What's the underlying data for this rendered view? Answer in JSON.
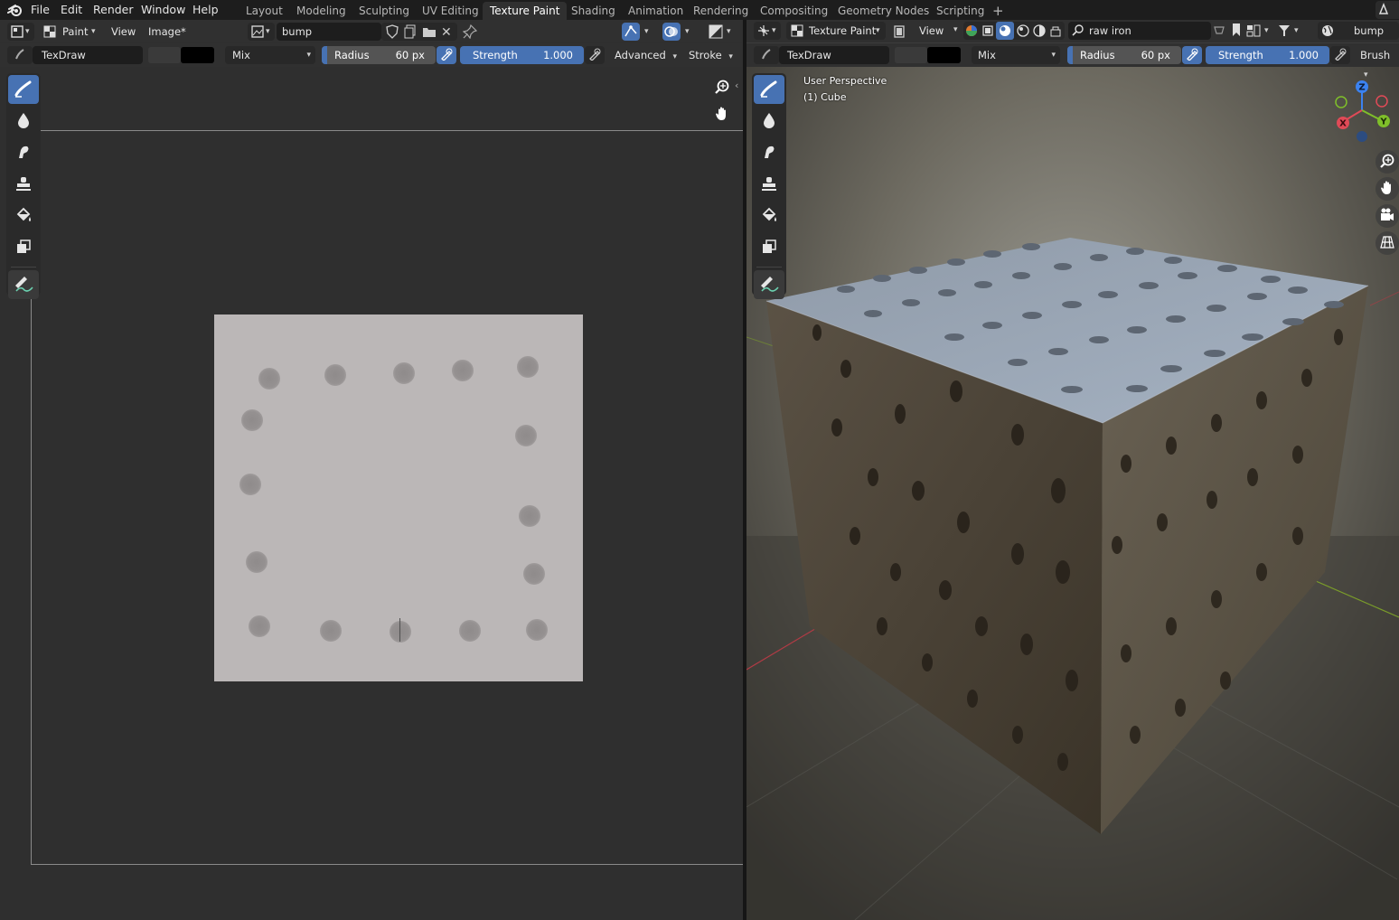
{
  "menu": {
    "items": [
      "File",
      "Edit",
      "Render",
      "Window",
      "Help"
    ]
  },
  "workspaces": {
    "tabs": [
      "Layout",
      "Modeling",
      "Sculpting",
      "UV Editing",
      "Texture Paint",
      "Shading",
      "Animation",
      "Rendering",
      "Compositing",
      "Geometry Nodes",
      "Scripting"
    ],
    "active": "Texture Paint",
    "add_label": "+"
  },
  "image_editor": {
    "header": {
      "mode": "Paint",
      "view": "View",
      "image_menu": "Image*",
      "image_name": "bump"
    },
    "tool_settings": {
      "brush": "TexDraw",
      "blend": "Mix",
      "radius_label": "Radius",
      "radius_value": "60 px",
      "strength_label": "Strength",
      "strength_value": "1.000",
      "advanced": "Advanced",
      "stroke": "Stroke"
    }
  },
  "viewport": {
    "header": {
      "mode": "Texture Paint",
      "view": "View",
      "material_search": "raw iron",
      "image_name": "bump"
    },
    "tool_settings": {
      "brush": "TexDraw",
      "blend": "Mix",
      "radius_label": "Radius",
      "radius_value": "60 px",
      "strength_label": "Strength",
      "strength_value": "1.000",
      "brush_panel": "Brush"
    },
    "overlay": {
      "perspective": "User Perspective",
      "object": "(1) Cube"
    },
    "gizmo": {
      "x": "X",
      "y": "Y",
      "z": "Z"
    }
  },
  "colors": {
    "accent": "#4772b3",
    "panel": "#303030",
    "background": "#2f2f2f",
    "texture": "#bbb7b7"
  },
  "tools": [
    "draw-brush-icon",
    "soften-icon",
    "smear-icon",
    "clone-icon",
    "fill-icon",
    "mask-icon",
    "annotate-icon"
  ]
}
